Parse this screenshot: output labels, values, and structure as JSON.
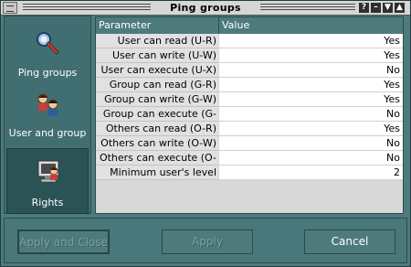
{
  "window": {
    "title": "Ping groups"
  },
  "titlebar_buttons": {
    "help": "?",
    "minimize": "–",
    "maximize": "▼",
    "close": "▲"
  },
  "sidebar": {
    "items": [
      {
        "label": "Ping groups",
        "icon": "ping-groups-icon",
        "selected": false
      },
      {
        "label": "User and group",
        "icon": "user-and-group-icon",
        "selected": false
      },
      {
        "label": "Rights",
        "icon": "rights-icon",
        "selected": true
      }
    ]
  },
  "grid": {
    "columns": [
      "Parameter",
      "Value"
    ],
    "rows": [
      {
        "param": "User can read (U-R)",
        "value": "Yes"
      },
      {
        "param": "User can write (U-W)",
        "value": "Yes"
      },
      {
        "param": "User can execute (U-X)",
        "value": "No"
      },
      {
        "param": "Group can read (G-R)",
        "value": "Yes"
      },
      {
        "param": "Group can write (G-W)",
        "value": "Yes"
      },
      {
        "param": "Group can execute (G-X)",
        "value": "No"
      },
      {
        "param": "Others can read (O-R)",
        "value": "Yes"
      },
      {
        "param": "Others can write (O-W)",
        "value": "No"
      },
      {
        "param": "Others can execute (O-X)",
        "value": "No"
      },
      {
        "param": "Minimum user's level",
        "value": "2"
      }
    ]
  },
  "buttons": {
    "apply_close": "Apply and Close",
    "apply": "Apply",
    "cancel": "Cancel"
  }
}
